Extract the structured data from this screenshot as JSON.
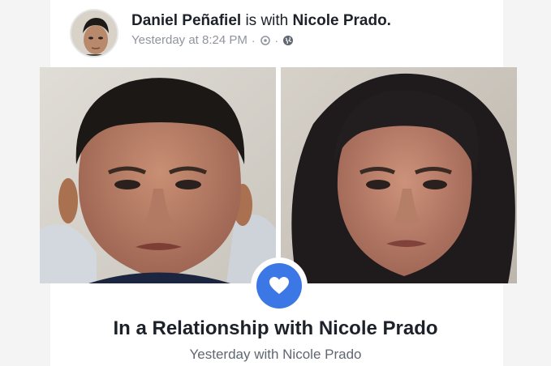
{
  "post": {
    "author": "Daniel Peñafiel",
    "with_text": "is with",
    "tagged": "Nicole Prado.",
    "timestamp": "Yesterday at 8:24 PM",
    "separator": "·",
    "icons": [
      "settings-icon",
      "globe-icon"
    ]
  },
  "photos": [
    {
      "subject": "boy-portrait-photo"
    },
    {
      "subject": "girl-portrait-photo"
    }
  ],
  "life_event": {
    "icon": "heart-icon",
    "accent_color": "#3b77e5",
    "title": "In a Relationship with Nicole Prado",
    "subtitle": "Yesterday with Nicole Prado"
  }
}
